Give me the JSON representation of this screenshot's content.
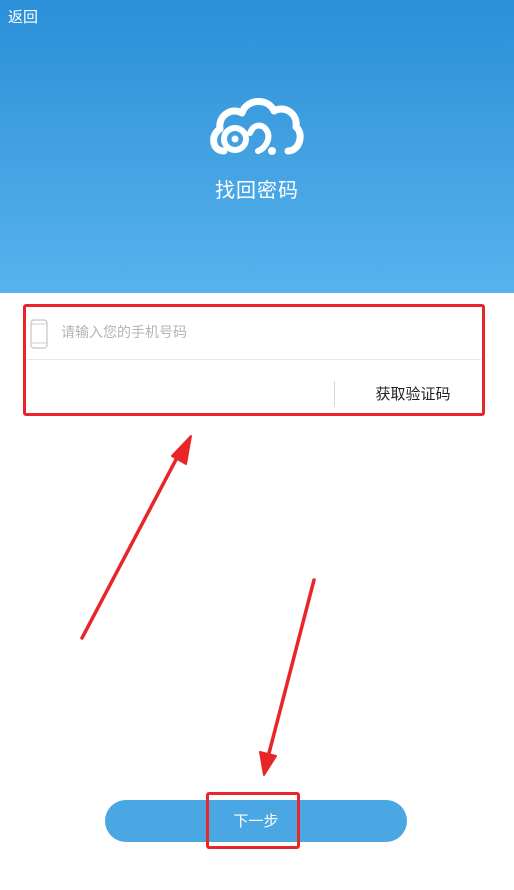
{
  "header": {
    "back_label": "返回",
    "title": "找回密码",
    "logo_icon": "cloud-logo-icon",
    "background_color": "#3f9fe0"
  },
  "form": {
    "phone_placeholder": "请输入您的手机号码",
    "phone_value": "",
    "phone_icon": "phone-icon",
    "code_value": "",
    "get_code_label": "获取验证码"
  },
  "next_button": {
    "label": "下一步",
    "color": "#4aa7e4"
  },
  "annotations": {
    "highlight_color": "#e8262a",
    "arrow_color": "#e8262a"
  }
}
